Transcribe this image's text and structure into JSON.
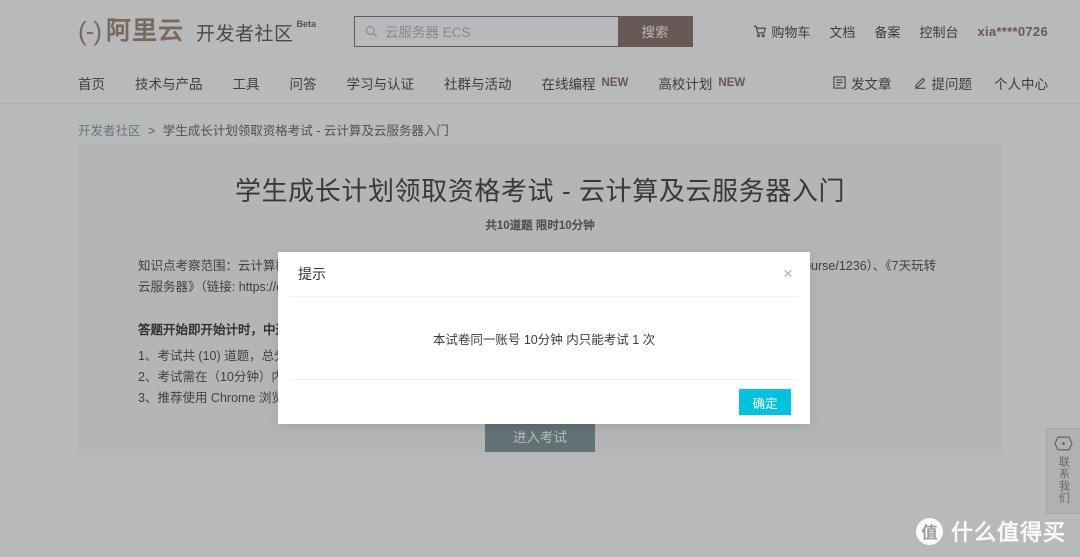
{
  "header": {
    "logo_bracket": "(-)",
    "logo_text": "阿里云",
    "sub_brand": "开发者社区",
    "beta": "Beta",
    "search": {
      "placeholder": "云服务器 ECS",
      "value": "",
      "button_label": "搜索",
      "icon": "search-icon"
    },
    "right_items": [
      {
        "label": "购物车",
        "icon": "cart-icon"
      },
      {
        "label": "文档",
        "icon": ""
      },
      {
        "label": "备案",
        "icon": ""
      },
      {
        "label": "控制台",
        "icon": ""
      },
      {
        "label": "xia****0726",
        "icon": ""
      }
    ]
  },
  "nav": {
    "items": [
      {
        "label": "首页",
        "badge": ""
      },
      {
        "label": "技术与产品",
        "badge": ""
      },
      {
        "label": "工具",
        "badge": ""
      },
      {
        "label": "问答",
        "badge": ""
      },
      {
        "label": "学习与认证",
        "badge": ""
      },
      {
        "label": "社群与活动",
        "badge": ""
      },
      {
        "label": "在线编程",
        "badge": "NEW"
      },
      {
        "label": "高校计划",
        "badge": "NEW"
      }
    ],
    "right_items": [
      {
        "label": "发文章",
        "icon": "article-icon"
      },
      {
        "label": "提问题",
        "icon": "pencil-icon"
      },
      {
        "label": "个人中心",
        "icon": ""
      }
    ]
  },
  "breadcrumb": {
    "root": "开发者社区",
    "separator": ">",
    "current": "学生成长计划领取资格考试 - 云计算及云服务器入门"
  },
  "exam": {
    "title": "学生成长计划领取资格考试 - 云计算及云服务器入门",
    "meta": "共10道题 限时10分钟",
    "description": "知识点考察范围：云计算概念、云服务器ECS基础知识。学习《云计算的前世今生》（链接: https://developer.aliyun.com/course/1236）、《7天玩转云服务器》（链接: https://developer.aliyu",
    "warning": "答题开始即开始计时，中途",
    "rules": [
      "1、考试共 (10) 道题，总分",
      "2、考试需在（10分钟）内",
      "3、推荐使用 Chrome 浏览"
    ],
    "enter_button": "进入考试"
  },
  "side_contact": {
    "label": "联系我们",
    "icon": "contact-icon"
  },
  "modal": {
    "title": "提示",
    "close_icon": "close-icon",
    "body": "本试卷同一账号 10分钟 内只能考试 1 次",
    "confirm_label": "确定"
  },
  "watermark": {
    "badge": "值",
    "text": "什么值得买"
  },
  "colors": {
    "brand_orange": "#ff6a00",
    "search_orange": "#e24a1a",
    "link_blue": "#3f9db5",
    "new_red": "#e8432f",
    "teal_button": "#17a0b8",
    "cyan_confirm": "#00c2e0"
  }
}
